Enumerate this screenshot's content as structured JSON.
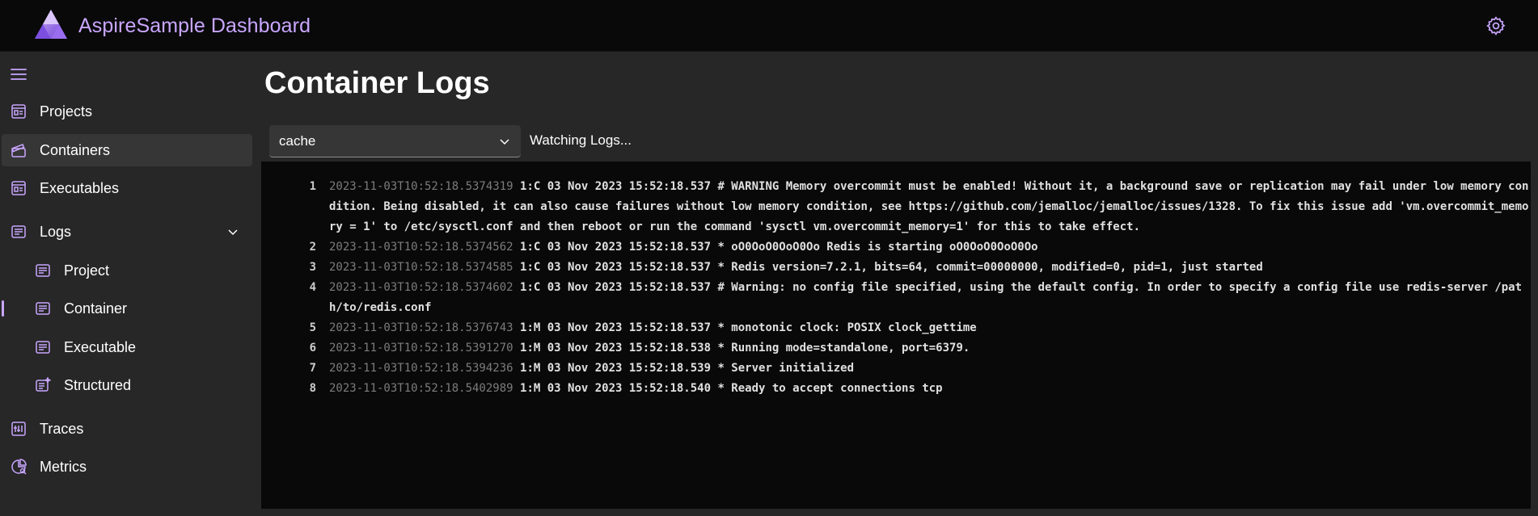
{
  "header": {
    "title": "AspireSample Dashboard",
    "logo_icon": "aspire-logo-icon",
    "settings_icon": "gear-icon"
  },
  "colors": {
    "accent": "#c9a6ff",
    "header_bg": "#090909",
    "body_bg": "#272727",
    "log_bg": "#090909",
    "selected_bg": "#363636"
  },
  "sidebar": {
    "menu_icon": "hamburger-icon",
    "items": [
      {
        "label": "Projects",
        "icon": "projects-icon"
      },
      {
        "label": "Containers",
        "icon": "containers-icon",
        "selected": true
      },
      {
        "label": "Executables",
        "icon": "executables-icon"
      },
      {
        "label": "Logs",
        "icon": "logs-icon",
        "expanded": true
      },
      {
        "label": "Project",
        "icon": "log-file-icon"
      },
      {
        "label": "Container",
        "icon": "log-file-icon",
        "active": true
      },
      {
        "label": "Executable",
        "icon": "log-file-icon"
      },
      {
        "label": "Structured",
        "icon": "structured-log-icon"
      },
      {
        "label": "Traces",
        "icon": "traces-icon"
      },
      {
        "label": "Metrics",
        "icon": "metrics-icon"
      }
    ]
  },
  "main": {
    "title": "Container Logs",
    "container_select": {
      "value": "cache"
    },
    "status": "Watching Logs...",
    "logs": [
      {
        "n": "1",
        "ts": "2023-11-03T10:52:18.5374319",
        "text": "1:C 03 Nov 2023 15:52:18.537 # WARNING Memory overcommit must be enabled! Without it, a background save or replication may fail under low memory condition. Being disabled, it can also cause failures without low memory condition, see https://github.com/jemalloc/jemalloc/issues/1328. To fix this issue add 'vm.overcommit_memory = 1' to /etc/sysctl.conf and then reboot or run the command 'sysctl vm.overcommit_memory=1' for this to take effect."
      },
      {
        "n": "2",
        "ts": "2023-11-03T10:52:18.5374562",
        "text": "1:C 03 Nov 2023 15:52:18.537 * oO0OoO0OoO0Oo Redis is starting oO0OoO0OoO0Oo"
      },
      {
        "n": "3",
        "ts": "2023-11-03T10:52:18.5374585",
        "text": "1:C 03 Nov 2023 15:52:18.537 * Redis version=7.2.1, bits=64, commit=00000000, modified=0, pid=1, just started"
      },
      {
        "n": "4",
        "ts": "2023-11-03T10:52:18.5374602",
        "text": "1:C 03 Nov 2023 15:52:18.537 # Warning: no config file specified, using the default config. In order to specify a config file use redis-server /path/to/redis.conf"
      },
      {
        "n": "5",
        "ts": "2023-11-03T10:52:18.5376743",
        "text": "1:M 03 Nov 2023 15:52:18.537 * monotonic clock: POSIX clock_gettime"
      },
      {
        "n": "6",
        "ts": "2023-11-03T10:52:18.5391270",
        "text": "1:M 03 Nov 2023 15:52:18.538 * Running mode=standalone, port=6379."
      },
      {
        "n": "7",
        "ts": "2023-11-03T10:52:18.5394236",
        "text": "1:M 03 Nov 2023 15:52:18.539 * Server initialized"
      },
      {
        "n": "8",
        "ts": "2023-11-03T10:52:18.5402989",
        "text": "1:M 03 Nov 2023 15:52:18.540 * Ready to accept connections tcp"
      }
    ]
  }
}
